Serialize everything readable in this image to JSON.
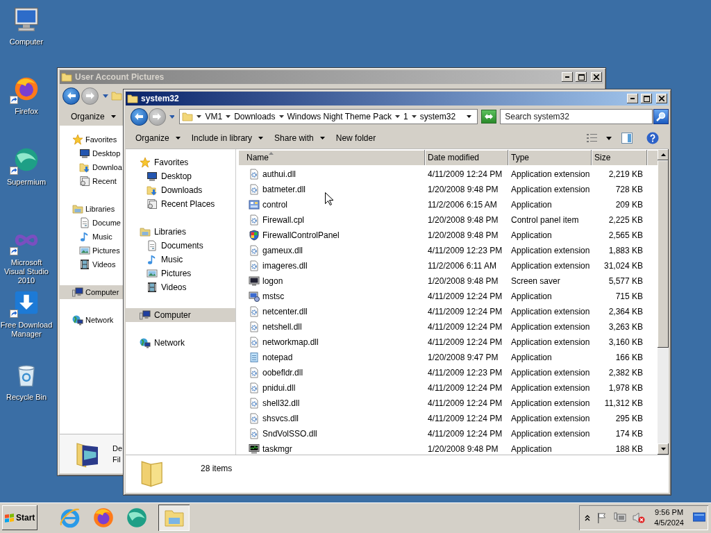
{
  "desktop_icons": [
    {
      "label": "Computer",
      "kind": "computer-big",
      "shortcut": false
    },
    {
      "label": "Firefox",
      "kind": "firefox",
      "shortcut": true
    },
    {
      "label": "Supermium",
      "kind": "sphere",
      "shortcut": true
    },
    {
      "label": "Microsoft Visual Studio 2010",
      "kind": "vs",
      "shortcut": true
    },
    {
      "label": "Free Download Manager",
      "kind": "fdm",
      "shortcut": true
    },
    {
      "label": "Recycle Bin",
      "kind": "recycle",
      "shortcut": false
    }
  ],
  "back_window": {
    "title": "User Account Pictures",
    "active": false,
    "back_enabled": true,
    "forward_enabled": false,
    "toolbar": [
      {
        "label": "Organize",
        "menu": true
      }
    ],
    "nav": [
      {
        "label": "Favorites",
        "kind": "star",
        "selected": false,
        "children": [
          {
            "label": "Desktop",
            "kind": "desktop",
            "selected": false
          },
          {
            "label": "Downloa",
            "kind": "downloads",
            "selected": false
          },
          {
            "label": "Recent",
            "kind": "recent",
            "selected": false
          }
        ]
      },
      {
        "label": "Libraries",
        "kind": "library",
        "selected": false,
        "children": [
          {
            "label": "Docume",
            "kind": "documents",
            "selected": false
          },
          {
            "label": "Music",
            "kind": "music",
            "selected": false
          },
          {
            "label": "Pictures",
            "kind": "pictures",
            "selected": false
          },
          {
            "label": "Videos",
            "kind": "videos",
            "selected": false
          }
        ]
      },
      {
        "label": "Computer",
        "kind": "computer",
        "selected": true
      },
      {
        "label": "Network",
        "kind": "network",
        "selected": false
      }
    ],
    "details": {
      "name": "De",
      "type": "Fil"
    }
  },
  "front_window": {
    "title": "system32",
    "active": true,
    "back_enabled": true,
    "forward_enabled": false,
    "breadcrumb": [
      "VM1",
      "Downloads",
      "Windows Night Theme Pack",
      "1",
      "system32"
    ],
    "search": {
      "placeholder": "Search system32"
    },
    "toolbar": [
      {
        "label": "Organize",
        "menu": true
      },
      {
        "label": "Include in library",
        "menu": true
      },
      {
        "label": "Share with",
        "menu": true
      },
      {
        "label": "New folder",
        "menu": false
      }
    ],
    "nav": [
      {
        "label": "Favorites",
        "kind": "star",
        "selected": false,
        "children": [
          {
            "label": "Desktop",
            "kind": "desktop",
            "selected": false
          },
          {
            "label": "Downloads",
            "kind": "downloads",
            "selected": false
          },
          {
            "label": "Recent Places",
            "kind": "recent",
            "selected": false
          }
        ]
      },
      {
        "label": "Libraries",
        "kind": "library",
        "selected": false,
        "children": [
          {
            "label": "Documents",
            "kind": "documents",
            "selected": false
          },
          {
            "label": "Music",
            "kind": "music",
            "selected": false
          },
          {
            "label": "Pictures",
            "kind": "pictures",
            "selected": false
          },
          {
            "label": "Videos",
            "kind": "videos",
            "selected": false
          }
        ]
      },
      {
        "label": "Computer",
        "kind": "computer",
        "selected": true
      },
      {
        "label": "Network",
        "kind": "network",
        "selected": false
      }
    ],
    "columns": [
      {
        "label": "Name",
        "sorted": true
      },
      {
        "label": "Date modified",
        "sorted": false
      },
      {
        "label": "Type",
        "sorted": false
      },
      {
        "label": "Size",
        "sorted": false
      }
    ],
    "files": [
      {
        "name": "authui.dll",
        "date": "4/11/2009 12:24 PM",
        "type": "Application extension",
        "size": "2,219 KB",
        "kind": "dll",
        "selected": false
      },
      {
        "name": "batmeter.dll",
        "date": "1/20/2008 9:48 PM",
        "type": "Application extension",
        "size": "728 KB",
        "kind": "dll",
        "selected": false
      },
      {
        "name": "control",
        "date": "11/2/2006 6:15 AM",
        "type": "Application",
        "size": "209 KB",
        "kind": "control",
        "selected": false
      },
      {
        "name": "Firewall.cpl",
        "date": "1/20/2008 9:48 PM",
        "type": "Control panel item",
        "size": "2,225 KB",
        "kind": "dll",
        "selected": false
      },
      {
        "name": "FirewallControlPanel",
        "date": "1/20/2008 9:48 PM",
        "type": "Application",
        "size": "2,565 KB",
        "kind": "shield",
        "selected": false
      },
      {
        "name": "gameux.dll",
        "date": "4/11/2009 12:23 PM",
        "type": "Application extension",
        "size": "1,883 KB",
        "kind": "dll",
        "selected": false
      },
      {
        "name": "imageres.dll",
        "date": "11/2/2006 6:11 AM",
        "type": "Application extension",
        "size": "31,024 KB",
        "kind": "dll",
        "selected": false
      },
      {
        "name": "logon",
        "date": "1/20/2008 9:48 PM",
        "type": "Screen saver",
        "size": "5,577 KB",
        "kind": "screensaver",
        "selected": false
      },
      {
        "name": "mstsc",
        "date": "4/11/2009 12:24 PM",
        "type": "Application",
        "size": "715 KB",
        "kind": "remote",
        "selected": false
      },
      {
        "name": "netcenter.dll",
        "date": "4/11/2009 12:24 PM",
        "type": "Application extension",
        "size": "2,364 KB",
        "kind": "dll",
        "selected": false
      },
      {
        "name": "netshell.dll",
        "date": "4/11/2009 12:24 PM",
        "type": "Application extension",
        "size": "3,263 KB",
        "kind": "dll",
        "selected": false
      },
      {
        "name": "networkmap.dll",
        "date": "4/11/2009 12:24 PM",
        "type": "Application extension",
        "size": "3,160 KB",
        "kind": "dll",
        "selected": false
      },
      {
        "name": "notepad",
        "date": "1/20/2008 9:47 PM",
        "type": "Application",
        "size": "166 KB",
        "kind": "notepad",
        "selected": false
      },
      {
        "name": "oobefldr.dll",
        "date": "4/11/2009 12:23 PM",
        "type": "Application extension",
        "size": "2,382 KB",
        "kind": "dll",
        "selected": false
      },
      {
        "name": "pnidui.dll",
        "date": "4/11/2009 12:24 PM",
        "type": "Application extension",
        "size": "1,978 KB",
        "kind": "dll",
        "selected": false
      },
      {
        "name": "shell32.dll",
        "date": "4/11/2009 12:24 PM",
        "type": "Application extension",
        "size": "11,312 KB",
        "kind": "dll",
        "selected": false
      },
      {
        "name": "shsvcs.dll",
        "date": "4/11/2009 12:24 PM",
        "type": "Application extension",
        "size": "295 KB",
        "kind": "dll",
        "selected": false
      },
      {
        "name": "SndVolSSO.dll",
        "date": "4/11/2009 12:24 PM",
        "type": "Application extension",
        "size": "174 KB",
        "kind": "dll",
        "selected": false
      },
      {
        "name": "taskmgr",
        "date": "1/20/2008 9:48 PM",
        "type": "Application",
        "size": "188 KB",
        "kind": "taskmgr",
        "selected": false
      }
    ],
    "status": "28 items"
  },
  "taskbar": {
    "start": "Start",
    "quick_launch": [
      {
        "kind": "ie"
      },
      {
        "kind": "firefox"
      },
      {
        "kind": "sphere"
      }
    ],
    "tasks": [
      {
        "kind": "explorer",
        "selected": true
      }
    ],
    "tray": {
      "muted": true,
      "time": "9:56 PM",
      "date": "4/5/2024"
    }
  }
}
